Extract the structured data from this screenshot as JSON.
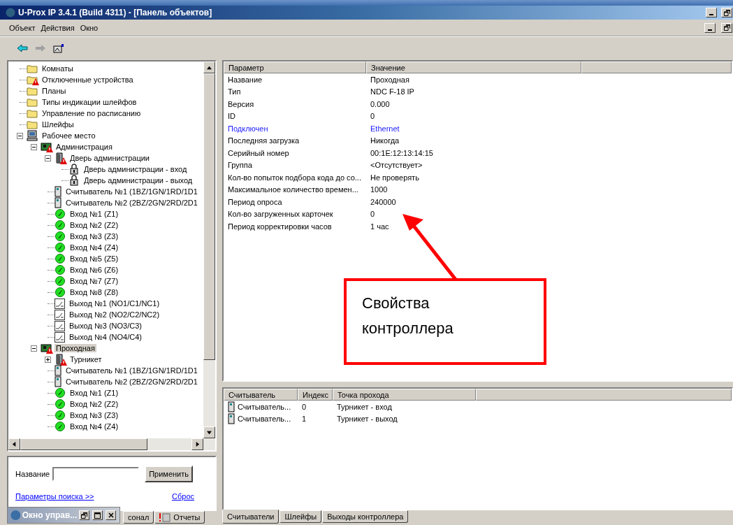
{
  "window": {
    "title": "U-Prox IP 3.4.1 (Build 4311) - [Панель объектов]"
  },
  "menu": [
    "Объект",
    "Действия",
    "Окно"
  ],
  "tree": [
    {
      "label": "Комнаты",
      "kind": "folder",
      "alert": false,
      "selected": false
    },
    {
      "label": "Отключенные устройства",
      "kind": "folder",
      "alert": true,
      "selected": false
    },
    {
      "label": "Планы",
      "kind": "folder",
      "alert": false,
      "selected": false
    },
    {
      "label": "Типы индикации шлейфов",
      "kind": "folder",
      "alert": false,
      "selected": false
    },
    {
      "label": "Управление по расписанию",
      "kind": "folder",
      "alert": false,
      "selected": false
    },
    {
      "label": "Шлейфы",
      "kind": "folder",
      "alert": false,
      "selected": false
    },
    {
      "label": "Рабочее место",
      "kind": "workstation",
      "alert": false,
      "selected": false,
      "expanded": true,
      "children": [
        {
          "label": "Администрация",
          "kind": "controller",
          "alert": true,
          "selected": false,
          "expanded": true,
          "children": [
            {
              "label": "Дверь администрации",
              "kind": "door",
              "alert": true,
              "selected": false,
              "expanded": true,
              "children": [
                {
                  "label": "Дверь администрации - вход",
                  "kind": "lock",
                  "alert": false,
                  "selected": false
                },
                {
                  "label": "Дверь администрации - выход",
                  "kind": "lock",
                  "alert": false,
                  "selected": false
                }
              ]
            },
            {
              "label": "Считыватель №1 (1BZ/1GN/1RD/1D1",
              "kind": "reader",
              "alert": false,
              "selected": false
            },
            {
              "label": "Считыватель №2 (2BZ/2GN/2RD/2D1",
              "kind": "reader",
              "alert": false,
              "selected": false
            },
            {
              "label": "Вход №1 (Z1)",
              "kind": "input",
              "alert": false,
              "selected": false
            },
            {
              "label": "Вход №2 (Z2)",
              "kind": "input",
              "alert": false,
              "selected": false
            },
            {
              "label": "Вход №3 (Z3)",
              "kind": "input",
              "alert": false,
              "selected": false
            },
            {
              "label": "Вход №4 (Z4)",
              "kind": "input",
              "alert": false,
              "selected": false
            },
            {
              "label": "Вход №5 (Z5)",
              "kind": "input",
              "alert": false,
              "selected": false
            },
            {
              "label": "Вход №6 (Z6)",
              "kind": "input",
              "alert": false,
              "selected": false
            },
            {
              "label": "Вход №7 (Z7)",
              "kind": "input",
              "alert": false,
              "selected": false
            },
            {
              "label": "Вход №8 (Z8)",
              "kind": "input",
              "alert": false,
              "selected": false
            },
            {
              "label": "Выход №1 (NO1/C1/NC1)",
              "kind": "output",
              "alert": false,
              "selected": false
            },
            {
              "label": "Выход №2 (NO2/C2/NC2)",
              "kind": "output",
              "alert": false,
              "selected": false
            },
            {
              "label": "Выход №3 (NO3/C3)",
              "kind": "output",
              "alert": false,
              "selected": false
            },
            {
              "label": "Выход №4 (NO4/C4)",
              "kind": "output",
              "alert": false,
              "selected": false
            }
          ]
        },
        {
          "label": "Проходная",
          "kind": "controller",
          "alert": true,
          "selected": true,
          "expanded": true,
          "children": [
            {
              "label": "Турникет",
              "kind": "door",
              "alert": true,
              "selected": false,
              "expanded": false
            },
            {
              "label": "Считыватель №1 (1BZ/1GN/1RD/1D1",
              "kind": "reader",
              "alert": false,
              "selected": false
            },
            {
              "label": "Считыватель №2 (2BZ/2GN/2RD/2D1",
              "kind": "reader",
              "alert": false,
              "selected": false
            },
            {
              "label": "Вход №1 (Z1)",
              "kind": "input",
              "alert": false,
              "selected": false
            },
            {
              "label": "Вход №2 (Z2)",
              "kind": "input",
              "alert": false,
              "selected": false
            },
            {
              "label": "Вход №3 (Z3)",
              "kind": "input",
              "alert": false,
              "selected": false
            },
            {
              "label": "Вход №4 (Z4)",
              "kind": "input",
              "alert": false,
              "selected": false
            }
          ]
        }
      ]
    }
  ],
  "search": {
    "label": "Название",
    "button": "Применить",
    "options_link": "Параметры поиска >>",
    "reset_link": "Сброс"
  },
  "left_tabs": [
    {
      "label": "сонал",
      "kind": "plain",
      "selected": false
    },
    {
      "label": "Отчеты",
      "kind": "reports",
      "selected": false
    }
  ],
  "minimized_window": {
    "title": "Окно управ..."
  },
  "properties": {
    "columns": [
      "Параметр",
      "Значение"
    ],
    "rows": [
      {
        "parameter": "Название",
        "value": "Проходная",
        "highlighted": false
      },
      {
        "parameter": "Тип",
        "value": "NDC F-18 IP",
        "highlighted": false
      },
      {
        "parameter": "Версия",
        "value": "0.000",
        "highlighted": false
      },
      {
        "parameter": "ID",
        "value": "0",
        "highlighted": false
      },
      {
        "parameter": "Подключен",
        "value": "Ethernet",
        "highlighted": true
      },
      {
        "parameter": "Последняя загрузка",
        "value": "Никогда",
        "highlighted": false
      },
      {
        "parameter": "Серийный номер",
        "value": "00:1E:12:13:14:15",
        "highlighted": false
      },
      {
        "parameter": "Группа",
        "value": "<Отсутствует>",
        "highlighted": false
      },
      {
        "parameter": "Кол-во попыток подбора кода до со...",
        "value": "Не проверять",
        "highlighted": false
      },
      {
        "parameter": "Максимальное количество времен...",
        "value": "1000",
        "highlighted": false
      },
      {
        "parameter": "Период опроса",
        "value": "240000",
        "highlighted": false
      },
      {
        "parameter": "Кол-во загруженных карточек",
        "value": "0",
        "highlighted": false
      },
      {
        "parameter": "Период корректировки часов",
        "value": "1 час",
        "highlighted": false
      }
    ]
  },
  "callout": {
    "text": "Свойства контроллера"
  },
  "readers": {
    "columns": [
      "Считыватель",
      "Индекс",
      "Точка прохода"
    ],
    "rows": [
      {
        "reader": "Считыватель...",
        "index": "0",
        "point": "Турникет - вход"
      },
      {
        "reader": "Считыватель...",
        "index": "1",
        "point": "Турникет - выход"
      }
    ]
  },
  "bottom_tabs": [
    {
      "label": "Считыватели",
      "selected": true
    },
    {
      "label": "Шлейфы",
      "selected": false
    },
    {
      "label": "Выходы контроллера",
      "selected": false
    }
  ]
}
